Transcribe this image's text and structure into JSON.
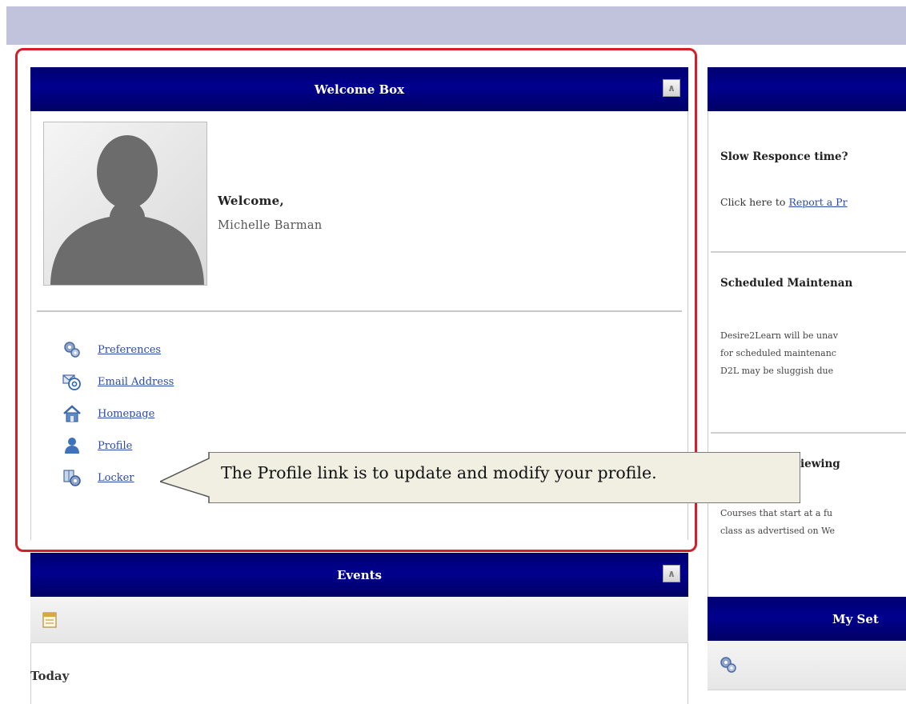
{
  "welcome_box": {
    "title": "Welcome Box",
    "greeting": "Welcome,",
    "user_name": "Michelle Barman",
    "links": [
      {
        "label": "Preferences",
        "icon": "gears-icon"
      },
      {
        "label": "Email Address",
        "icon": "email-icon"
      },
      {
        "label": "Homepage",
        "icon": "home-icon"
      },
      {
        "label": "Profile",
        "icon": "person-icon"
      },
      {
        "label": "Locker",
        "icon": "locker-icon"
      }
    ]
  },
  "callout": {
    "text": "The Profile link is to update and modify your profile."
  },
  "events": {
    "title": "Events",
    "today_label": "Today"
  },
  "news": {
    "item1_title": "Slow Responce time?",
    "item1_text": "Click here to ",
    "item1_link": "Report a Pr",
    "item2_title": "Scheduled Maintenan",
    "item2_line1": "Desire2Learn will be unav",
    "item2_line2": "for scheduled maintenanc",
    "item2_line3": "D2L may be sluggish due",
    "item3_title": "iewing",
    "item3_line1": "Courses that start at a fu",
    "item3_line2": "class as advertised on We"
  },
  "my_settings": {
    "title": "My Set"
  },
  "colors": {
    "header_navy": "#000080",
    "highlight_red": "#d61e2b",
    "link_blue": "#2b4aa8",
    "top_strip": "#c1c3dd"
  }
}
